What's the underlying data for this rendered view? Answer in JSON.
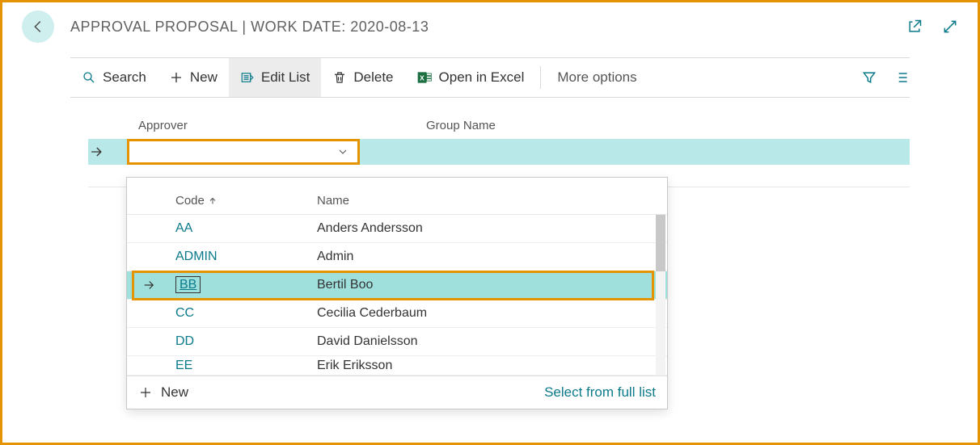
{
  "header": {
    "title": "APPROVAL PROPOSAL | WORK DATE: 2020-08-13"
  },
  "toolbar": {
    "search": "Search",
    "new": "New",
    "edit_list": "Edit List",
    "delete": "Delete",
    "open_excel": "Open in Excel",
    "more_options": "More options"
  },
  "columns": {
    "approver": "Approver",
    "group_name": "Group Name"
  },
  "approver_input": {
    "value": ""
  },
  "dropdown": {
    "header": {
      "code": "Code",
      "name": "Name"
    },
    "rows": [
      {
        "code": "AA",
        "name": "Anders Andersson",
        "selected": false
      },
      {
        "code": "ADMIN",
        "name": "Admin",
        "selected": false
      },
      {
        "code": "BB",
        "name": "Bertil Boo",
        "selected": true
      },
      {
        "code": "CC",
        "name": "Cecilia Cederbaum",
        "selected": false
      },
      {
        "code": "DD",
        "name": "David Danielsson",
        "selected": false
      },
      {
        "code": "EE",
        "name": "Erik Eriksson",
        "selected": false
      }
    ],
    "footer": {
      "new": "New",
      "select_full": "Select from full list"
    }
  }
}
